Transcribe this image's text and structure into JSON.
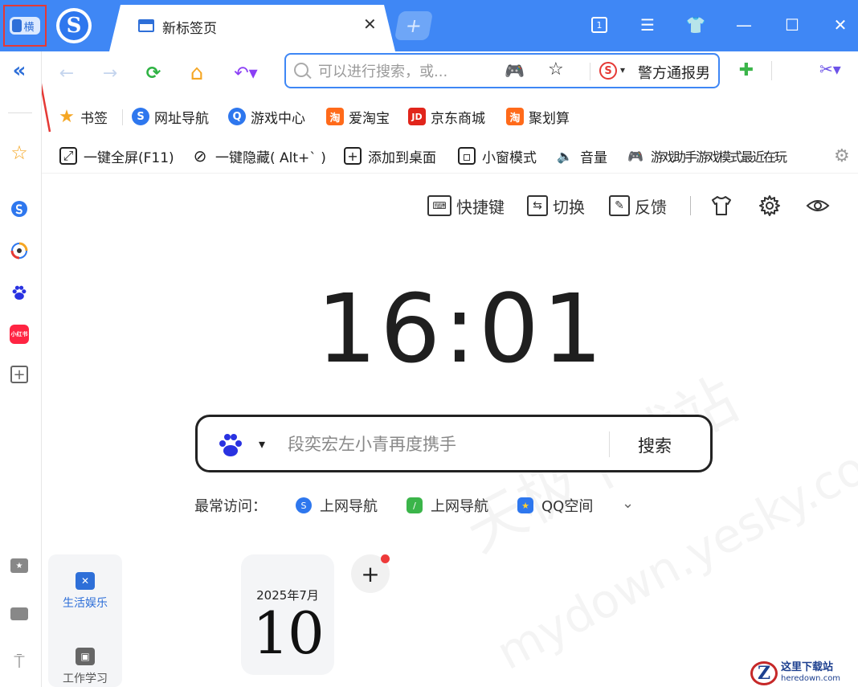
{
  "titlebar": {
    "mode_toggle_label": "横",
    "logo_letter": "S",
    "tab_title": "新标签页",
    "tab_close": "✕",
    "new_tab": "+",
    "tab_count": "1",
    "menu": "☰",
    "skin": "👕",
    "minimize": "—",
    "maximize": "☐",
    "close": "✕"
  },
  "nav": {
    "collapse": "«",
    "back": "←",
    "forward": "→",
    "refresh": "⟳",
    "home": "⌂",
    "undo": "↶▾",
    "address_placeholder": "可以进行搜索，或...",
    "game_icon": "🎮",
    "favorite_icon": "☆",
    "engine_letter": "S",
    "engine_caret": "▾",
    "hot_search": "警方通报男",
    "ext": "✚",
    "cut": "✂▾"
  },
  "bookmarks": {
    "items": [
      {
        "label": "书签",
        "icon": "★"
      },
      {
        "label": "网址导航",
        "icon": "S"
      },
      {
        "label": "游戏中心",
        "icon": "Q"
      },
      {
        "label": "爱淘宝",
        "icon": "淘"
      },
      {
        "label": "京东商城",
        "icon": "JD"
      },
      {
        "label": "聚划算",
        "icon": "淘"
      }
    ]
  },
  "gametools": {
    "items": [
      {
        "label": "一键全屏(F11)",
        "icon": "⤢"
      },
      {
        "label": "一键隐藏( Alt+` )",
        "icon": "⊘"
      },
      {
        "label": "添加到桌面",
        "icon": "+"
      },
      {
        "label": "小窗模式",
        "icon": "▫"
      },
      {
        "label": "音量",
        "icon": "🔈"
      },
      {
        "label": "游戏助手游戏模式最近在玩",
        "icon": "🎮"
      }
    ],
    "settings_icon": "⚙"
  },
  "main": {
    "shortcuts_label": "快捷键",
    "switch_label": "切换",
    "feedback_label": "反馈",
    "clock": "16:01",
    "search_placeholder": "段奕宏左小青再度携手",
    "search_button": "搜索",
    "engine_caret": "▾",
    "frequent_label": "最常访问：",
    "frequent_items": [
      {
        "label": "上网导航",
        "icon": "S"
      },
      {
        "label": "上网导航",
        "icon": "/"
      },
      {
        "label": "QQ空间",
        "icon": "★"
      }
    ],
    "frequent_more": "⌄",
    "categories": [
      {
        "label": "生活娱乐",
        "icon": "✕"
      },
      {
        "label": "工作学习",
        "icon": "▣"
      }
    ],
    "calendar_month": "2025年7月",
    "calendar_day": "10",
    "add_widget": "+"
  },
  "watermark": {
    "text1": "天极下载站",
    "text2": "mydown.yesky.com"
  },
  "badge": {
    "letter": "Z",
    "title": "这里下载站",
    "url": "heredown.com"
  },
  "colors": {
    "titlebar": "#3f87f5",
    "accent": "#2e6fd8",
    "highlight_box": "#e53935"
  }
}
